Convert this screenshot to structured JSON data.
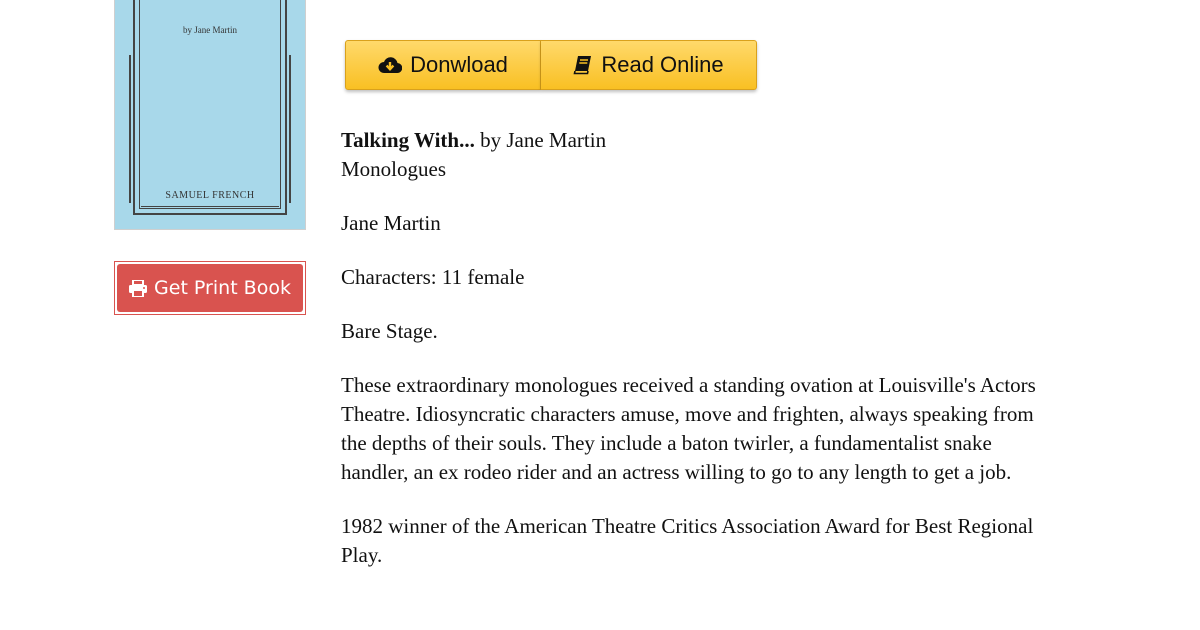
{
  "cover": {
    "author_line": "by Jane Martin",
    "publisher": "SAMUEL FRENCH"
  },
  "print_button": {
    "label": "Get Print Book",
    "icon": "print-icon"
  },
  "actions": {
    "download_label": "Donwload",
    "download_icon": "cloud-download-icon",
    "read_label": "Read Online",
    "read_icon": "book-icon"
  },
  "description": {
    "title": "Talking With...",
    "byline": " by Jane Martin",
    "genre": "Monologues",
    "author": "Jane Martin",
    "characters": "Characters: 11 female",
    "setting": "Bare Stage.",
    "summary": "These extraordinary monologues received a standing ovation at Louisville's Actors Theatre. Idiosyncratic characters amuse, move and frighten, always speaking from the depths of their souls. They include a baton twirler, a fundamentalist snake handler, an ex rodeo rider and an actress willing to go to any length to get a job.",
    "award": "1982 winner of the American Theatre Critics Association Award for Best Regional Play."
  },
  "colors": {
    "cover_background": "#a8d8ea",
    "print_button": "#d9534f",
    "action_button": "#f9c023"
  }
}
